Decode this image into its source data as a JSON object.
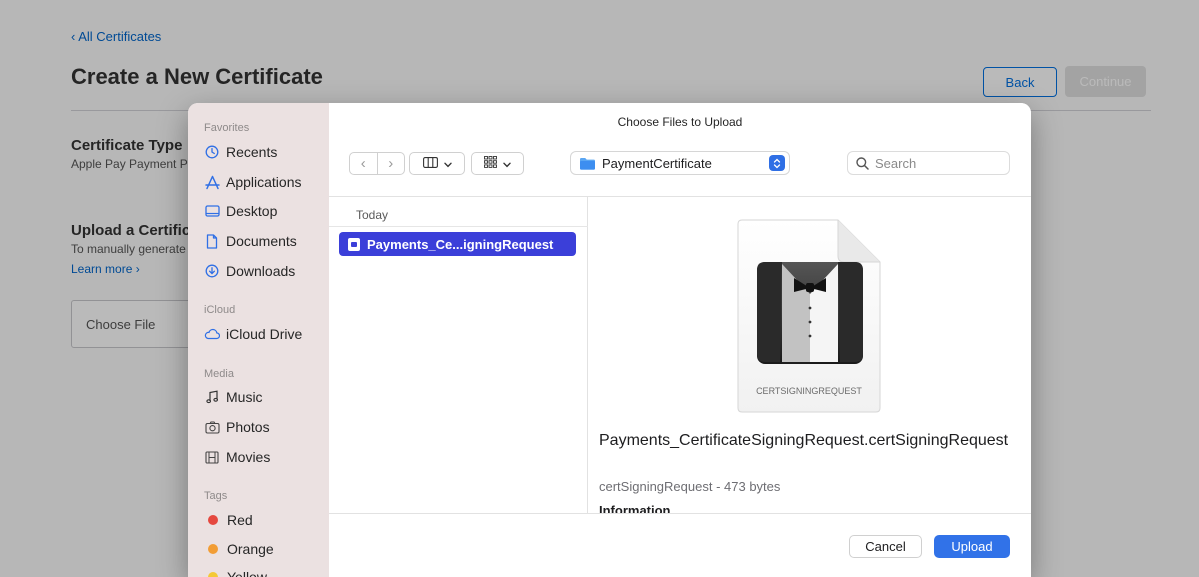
{
  "background_page": {
    "back_link": "‹ All Certificates",
    "title": "Create a New Certificate",
    "back_button": "Back",
    "continue_button": "Continue",
    "certificate_type": {
      "title": "Certificate Type",
      "subtitle": "Apple Pay Payment Processing Certificate"
    },
    "upload_section": {
      "title": "Upload a Certificate Signing Request",
      "subtitle": "To manually generate a Certificate, you need a Certificate Signing Request (CSR) file from your Mac.",
      "learn_more": "Learn more ›"
    },
    "choose_file": "Choose File"
  },
  "dialog": {
    "title": "Choose Files to Upload",
    "sidebar": {
      "favorites_header": "Favorites",
      "favorites": [
        {
          "label": "Recents",
          "icon": "clock-icon"
        },
        {
          "label": "Applications",
          "icon": "applications-icon"
        },
        {
          "label": "Desktop",
          "icon": "desktop-icon"
        },
        {
          "label": "Documents",
          "icon": "document-icon"
        },
        {
          "label": "Downloads",
          "icon": "download-icon"
        }
      ],
      "icloud_header": "iCloud",
      "icloud": [
        {
          "label": "iCloud Drive",
          "icon": "cloud-icon"
        }
      ],
      "media_header": "Media",
      "media": [
        {
          "label": "Music",
          "icon": "music-icon"
        },
        {
          "label": "Photos",
          "icon": "camera-icon"
        },
        {
          "label": "Movies",
          "icon": "film-icon"
        }
      ],
      "tags_header": "Tags",
      "tags": [
        {
          "label": "Red",
          "color": "#e5483f"
        },
        {
          "label": "Orange",
          "color": "#f29d35"
        },
        {
          "label": "Yellow",
          "color": "#f4c936"
        }
      ]
    },
    "toolbar": {
      "back_glyph": "‹",
      "forward_glyph": "›",
      "location": "PaymentCertificate",
      "search_placeholder": "Search"
    },
    "browser": {
      "column_header": "Today",
      "selected_file": "Payments_Ce...igningRequest"
    },
    "preview": {
      "icon_label": "CERTSIGNINGREQUEST",
      "file_name": "Payments_CertificateSigningRequest.certSigningRequest",
      "meta": "certSigningRequest - 473 bytes",
      "info_heading": "Information"
    },
    "buttons": {
      "cancel": "Cancel",
      "upload": "Upload"
    },
    "colors": {
      "accent": "#3172e8",
      "selection": "#3b3fd9",
      "sidebar_bg": "#ebe1e1"
    }
  }
}
